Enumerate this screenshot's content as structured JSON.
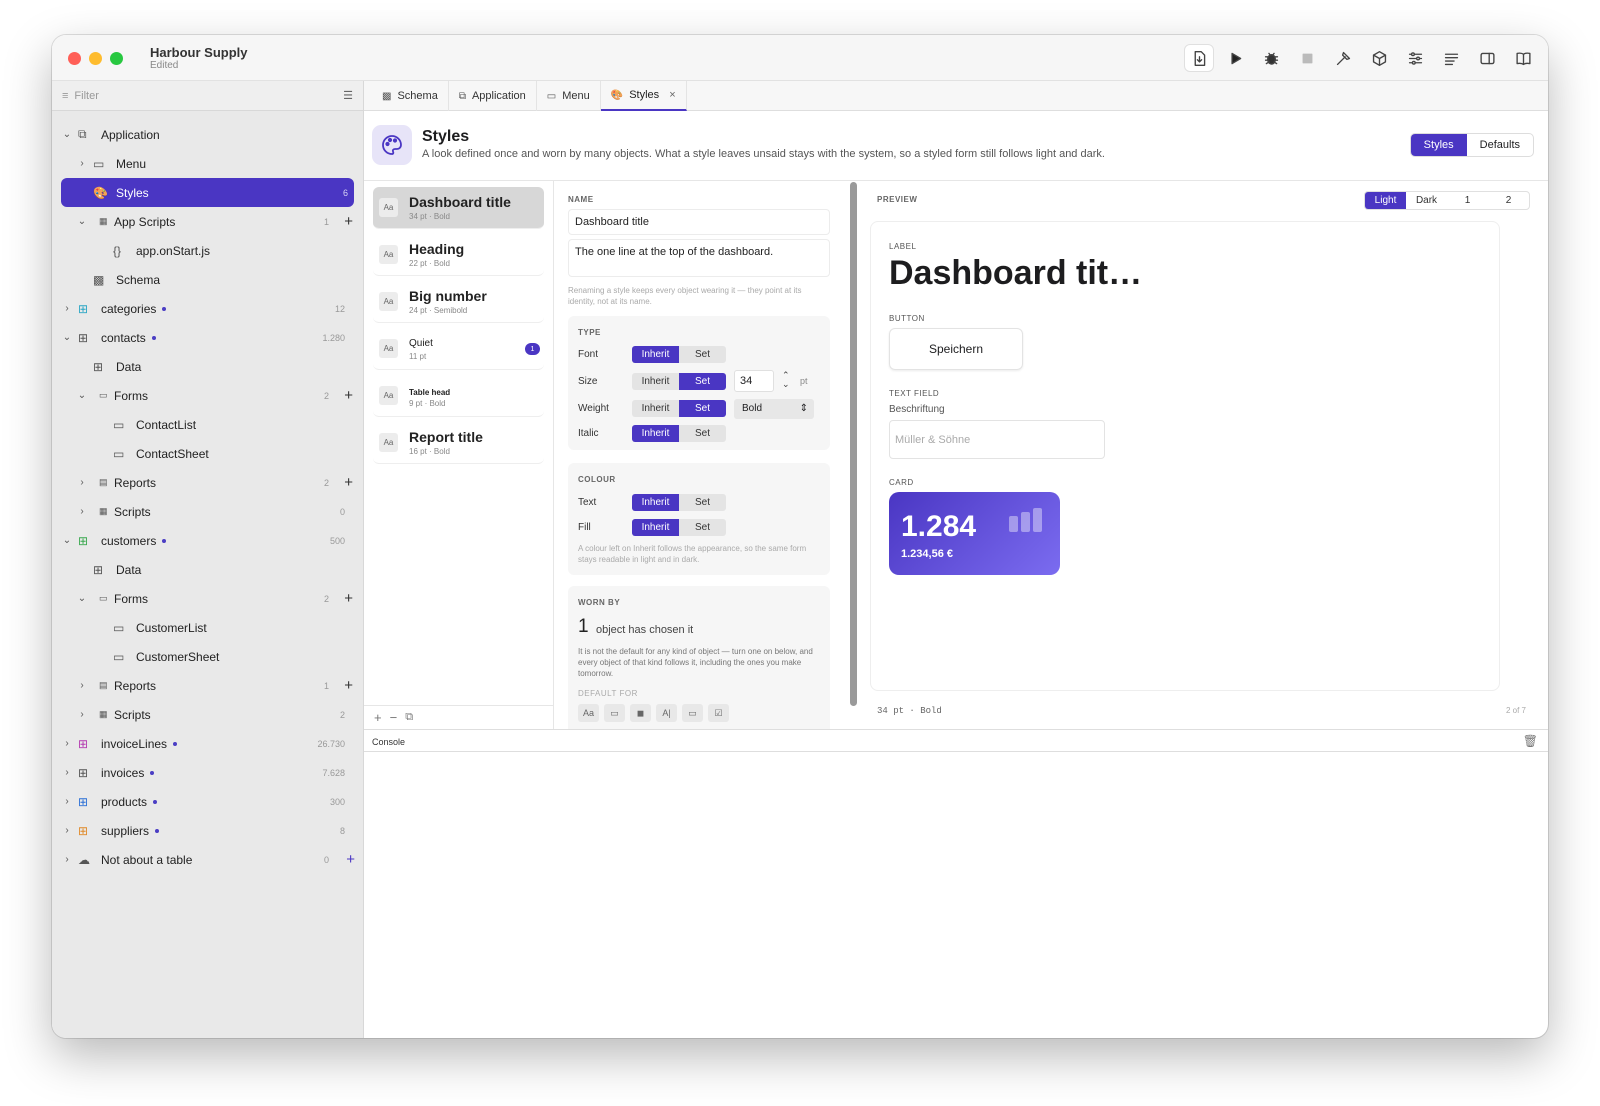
{
  "window": {
    "title": "Harbour Supply",
    "subtitle": "Edited"
  },
  "toolbar": [
    "export-icon",
    "run-icon",
    "debug-icon",
    "stop-icon",
    "build-icon",
    "package-icon",
    "settings-sliders-icon",
    "lines-icon",
    "split-view-icon",
    "book-icon"
  ],
  "sidebar": {
    "filter_placeholder": "Filter",
    "rows": [
      {
        "label": "Application",
        "indent": 0,
        "chev": "⌄",
        "icon": "⧉",
        "name": "application"
      },
      {
        "label": "Menu",
        "indent": 1,
        "chev": "›",
        "icon": "▭",
        "name": "menu"
      },
      {
        "label": "Styles",
        "indent": 1,
        "icon": "🎨",
        "count": "6",
        "sel": true,
        "name": "styles"
      },
      {
        "label": "App Scripts",
        "indent": 1,
        "chev": "⌄",
        "icon": "▦",
        "count": "1",
        "plus": true,
        "small": true,
        "name": "app-scripts"
      },
      {
        "label": "app.onStart.js",
        "indent": 2,
        "icon": "{}",
        "name": "app-onstart"
      },
      {
        "label": "Schema",
        "indent": 1,
        "icon": "▩",
        "name": "schema"
      },
      {
        "label": "categories",
        "indent": 0,
        "chev": "›",
        "icon": "⊞",
        "dot": true,
        "count": "12",
        "color": "#2aa6c4",
        "name": "categories"
      },
      {
        "label": "contacts",
        "indent": 0,
        "chev": "⌄",
        "icon": "⊞",
        "dot": true,
        "count": "1.280",
        "color": "#555",
        "name": "contacts"
      },
      {
        "label": "Data",
        "indent": 1,
        "icon": "⊞",
        "name": "contacts-data"
      },
      {
        "label": "Forms",
        "indent": 1,
        "chev": "⌄",
        "icon": "▭",
        "count": "2",
        "plus": true,
        "small": true,
        "name": "contacts-forms"
      },
      {
        "label": "ContactList",
        "indent": 2,
        "icon": "▭",
        "name": "contactlist"
      },
      {
        "label": "ContactSheet",
        "indent": 2,
        "icon": "▭",
        "name": "contactsheet"
      },
      {
        "label": "Reports",
        "indent": 1,
        "chev": "›",
        "icon": "▤",
        "count": "2",
        "plus": true,
        "small": true,
        "name": "contacts-reports"
      },
      {
        "label": "Scripts",
        "indent": 1,
        "chev": "›",
        "icon": "▦",
        "count": "0",
        "small": true,
        "name": "contacts-scripts"
      },
      {
        "label": "customers",
        "indent": 0,
        "chev": "⌄",
        "icon": "⊞",
        "dot": true,
        "count": "500",
        "color": "#3aa84f",
        "name": "customers"
      },
      {
        "label": "Data",
        "indent": 1,
        "icon": "⊞",
        "name": "customers-data"
      },
      {
        "label": "Forms",
        "indent": 1,
        "chev": "⌄",
        "icon": "▭",
        "count": "2",
        "plus": true,
        "small": true,
        "name": "customers-forms"
      },
      {
        "label": "CustomerList",
        "indent": 2,
        "icon": "▭",
        "name": "customerlist"
      },
      {
        "label": "CustomerSheet",
        "indent": 2,
        "icon": "▭",
        "name": "customersheet"
      },
      {
        "label": "Reports",
        "indent": 1,
        "chev": "›",
        "icon": "▤",
        "count": "1",
        "plus": true,
        "small": true,
        "name": "customers-reports"
      },
      {
        "label": "Scripts",
        "indent": 1,
        "chev": "›",
        "icon": "▦",
        "count": "2",
        "small": true,
        "name": "customers-scripts"
      },
      {
        "label": "invoiceLines",
        "indent": 0,
        "chev": "›",
        "icon": "⊞",
        "dot": true,
        "count": "26.730",
        "color": "#b43ab0",
        "name": "invoicelines"
      },
      {
        "label": "invoices",
        "indent": 0,
        "chev": "›",
        "icon": "⊞",
        "dot": true,
        "count": "7.628",
        "color": "#555",
        "name": "invoices"
      },
      {
        "label": "products",
        "indent": 0,
        "chev": "›",
        "icon": "⊞",
        "dot": true,
        "count": "300",
        "color": "#2b6fd6",
        "name": "products"
      },
      {
        "label": "suppliers",
        "indent": 0,
        "chev": "›",
        "icon": "⊞",
        "dot": true,
        "count": "8",
        "color": "#e08a2a",
        "name": "suppliers"
      },
      {
        "label": "Not about a table",
        "indent": 0,
        "chev": "›",
        "icon": "☁",
        "count": "0",
        "plus": true,
        "bluePlus": true,
        "name": "not-about-table"
      }
    ]
  },
  "tabs": [
    {
      "label": "Schema",
      "icon": "▩"
    },
    {
      "label": "Application",
      "icon": "⧉"
    },
    {
      "label": "Menu",
      "icon": "▭"
    },
    {
      "label": "Styles",
      "icon": "🎨",
      "active": true,
      "close": "×"
    }
  ],
  "header": {
    "title": "Styles",
    "description": "A look defined once and worn by many objects. What a style leaves unsaid stays with the system, so a styled form still follows light and dark.",
    "seg": [
      "Styles",
      "Defaults"
    ]
  },
  "styles_list": [
    {
      "name": "Dashboard title",
      "sub": "34 pt · Bold",
      "size": 14,
      "sel": true
    },
    {
      "name": "Heading",
      "sub": "22 pt · Bold",
      "size": 14
    },
    {
      "name": "Big number",
      "sub": "24 pt · Semibold",
      "size": 14
    },
    {
      "name": "Quiet",
      "sub": "11 pt",
      "size": 10,
      "badge": "1",
      "light": true
    },
    {
      "name": "Table head",
      "sub": "9 pt · Bold",
      "size": 8
    },
    {
      "name": "Report title",
      "sub": "16 pt · Bold",
      "size": 14
    }
  ],
  "list_footer": [
    "+",
    "−",
    "⧉"
  ],
  "editor": {
    "name_label": "NAME",
    "name_value": "Dashboard title",
    "description": "The one line at the top of the dashboard.",
    "rename_hint": "Renaming a style keeps every object wearing it — they point at its identity, not at its name.",
    "type_label": "TYPE",
    "font_label": "Font",
    "size_label": "Size",
    "weight_label": "Weight",
    "italic_label": "Italic",
    "inherit": "Inherit",
    "set": "Set",
    "size_value": "34",
    "size_unit": "pt",
    "weight_value": "Bold",
    "colour_label": "COLOUR",
    "text_label": "Text",
    "fill_label": "Fill",
    "colour_hint": "A colour left on Inherit follows the appearance, so the same form stays readable in light and in dark.",
    "worn_label": "WORN BY",
    "worn_count": "1",
    "worn_text": "object has chosen it",
    "worn_hint": "It is not the default for any kind of object — turn one on below, and every object of that kind follows it, including the ones you make tomorrow.",
    "default_for": "DEFAULT FOR",
    "default_icons": [
      "Aa",
      "▭",
      "◼",
      "A|",
      "▭",
      "☑"
    ]
  },
  "preview": {
    "label": "PREVIEW",
    "modes": [
      "Light",
      "Dark",
      "1",
      "2"
    ],
    "label_caption": "LABEL",
    "label_text": "Dashboard tit…",
    "button_caption": "BUTTON",
    "button_text": "Speichern",
    "field_caption": "TEXT FIELD",
    "field_label": "Beschriftung",
    "field_placeholder": "Müller & Söhne",
    "card_caption": "CARD",
    "card_value": "1.284",
    "card_sub": "1.234,56 €",
    "card_colors": [
      "#4a36c3",
      "#7b6cf0"
    ],
    "footer_left": "34 pt · Bold",
    "footer_right": "2 of 7"
  },
  "console": {
    "label": "Console"
  }
}
